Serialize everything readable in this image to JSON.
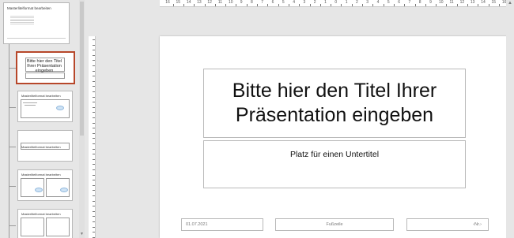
{
  "thumbnails": {
    "master_title": "Masterlitelformat bearbeiten",
    "slide1_title": "Bitte hier den Titel Ihrer Präsentation eingeben",
    "slide2_title": "Masterlitelformat bearbeiten",
    "slide3_title": "Masterlitelformat bearbeiten",
    "slide4_title": "Masterlitelformat bearbeiten",
    "slide5_title": "Masterlitelformat bearbeiten",
    "selected_index": 1,
    "accent_color": "#b7472a"
  },
  "ruler": {
    "labels": [
      "16",
      "15",
      "14",
      "13",
      "12",
      "11",
      "10",
      "9",
      "8",
      "7",
      "6",
      "5",
      "4",
      "3",
      "2",
      "1",
      "0",
      "1",
      "2",
      "3",
      "4",
      "5",
      "6",
      "7",
      "8",
      "9",
      "10",
      "11",
      "12",
      "13",
      "14",
      "15",
      "16"
    ]
  },
  "slide": {
    "title": "Bitte hier den Titel Ihrer Präsentation eingeben",
    "subtitle": "Platz für einen Untertitel",
    "date": "01.07.2021",
    "footer": "Fußzeile",
    "slide_number": "‹Nr.›"
  }
}
